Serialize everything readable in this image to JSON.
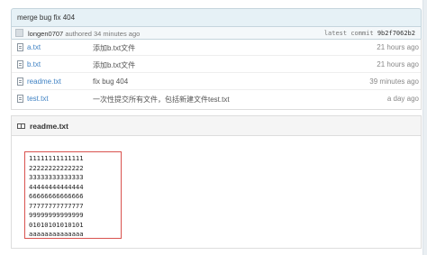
{
  "commit": {
    "title": "merge bug fix 404",
    "author": "longen0707",
    "authored_text": "authored 34 minutes ago",
    "latest_label": "latest commit",
    "sha": "9b2f7062b2"
  },
  "files": [
    {
      "name": "a.txt",
      "message": "添加b.txt文件",
      "age": "21 hours ago"
    },
    {
      "name": "b.txt",
      "message": "添加b.txt文件",
      "age": "21 hours ago"
    },
    {
      "name": "readme.txt",
      "message": "fix bug 404",
      "age": "39 minutes ago"
    },
    {
      "name": "test.txt",
      "message": "一次性提交所有文件，包括新建文件test.txt",
      "age": "a day ago"
    }
  ],
  "readme": {
    "title": "readme.txt",
    "lines": [
      "11111111111111",
      "22222222222222",
      "33333333333333",
      "44444444444444",
      "66666666666666",
      "77777777777777",
      "99999999999999",
      "01010101010101",
      "aaaaaaaaaaaaaa"
    ]
  },
  "colors": {
    "link": "#4183c4",
    "highlight_border": "#d9534f",
    "commit_bar": "#e6f1f6"
  }
}
